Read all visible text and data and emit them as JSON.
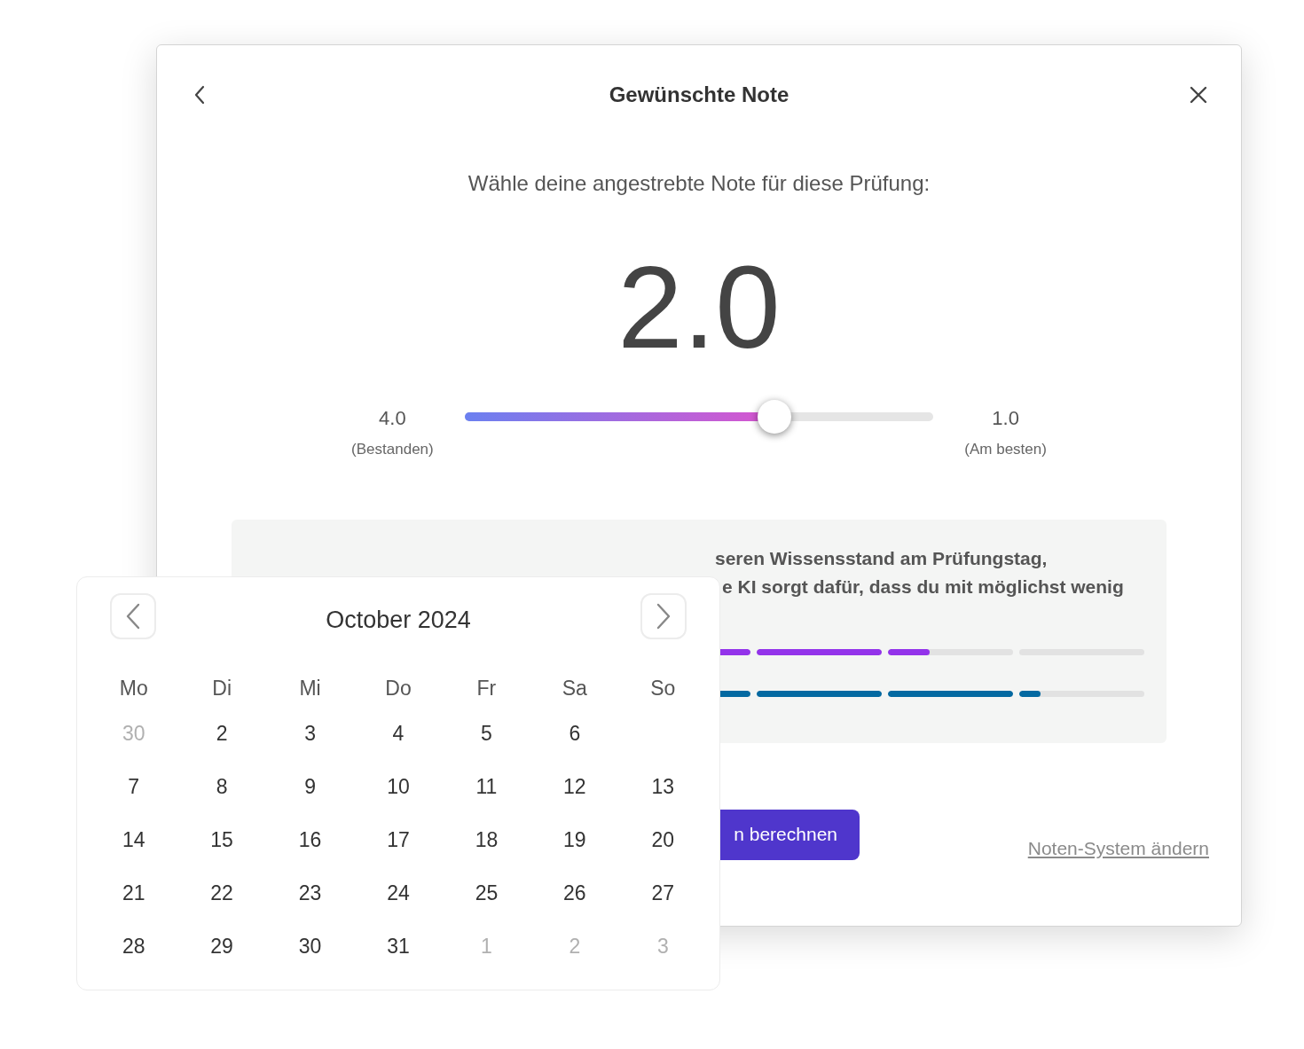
{
  "dialog": {
    "title": "Gewünschte Note",
    "prompt": "Wähle deine angestrebte Note für diese Prüfung:",
    "grade": "2.0",
    "slider": {
      "min_label": "4.0",
      "min_caption": "(Bestanden)",
      "max_label": "1.0",
      "max_caption": "(Am besten)",
      "level": 0.66
    },
    "info": {
      "lines": [
        "seren Wissensstand am Prüfungstag,",
        "e KI sorgt dafür, dass du mit möglichst wenig"
      ],
      "progress_rows": [
        {
          "color": "#9333ea",
          "segments": [
            {
              "level": 1
            },
            {
              "level": 1
            },
            {
              "level": 0.33
            },
            {
              "level": 0
            }
          ]
        },
        {
          "color": "#0369a1",
          "segments": [
            {
              "level": 1
            },
            {
              "level": 1
            },
            {
              "level": 1
            },
            {
              "level": 0.17
            }
          ]
        }
      ]
    },
    "primary_button": "n berechnen",
    "link": "Noten-System ändern"
  },
  "calendar": {
    "month": "October 2024",
    "weekdays": [
      "Mo",
      "Di",
      "Mi",
      "Do",
      "Fr",
      "Sa",
      "So"
    ],
    "weeks": [
      [
        {
          "day": "30",
          "outside": true
        },
        {
          "day": "2",
          "outside": false
        },
        {
          "day": "3",
          "outside": false
        },
        {
          "day": "4",
          "outside": false
        },
        {
          "day": "5",
          "outside": false
        },
        {
          "day": "6",
          "outside": false
        }
      ],
      [
        {
          "day": "7",
          "outside": false
        },
        {
          "day": "8",
          "outside": false
        },
        {
          "day": "9",
          "outside": false
        },
        {
          "day": "10",
          "outside": false
        },
        {
          "day": "11",
          "outside": false
        },
        {
          "day": "12",
          "outside": false
        },
        {
          "day": "13",
          "outside": false
        }
      ],
      [
        {
          "day": "14",
          "outside": false
        },
        {
          "day": "15",
          "outside": false
        },
        {
          "day": "16",
          "outside": false
        },
        {
          "day": "17",
          "outside": false
        },
        {
          "day": "18",
          "outside": false
        },
        {
          "day": "19",
          "outside": false
        },
        {
          "day": "20",
          "outside": false
        }
      ],
      [
        {
          "day": "21",
          "outside": false
        },
        {
          "day": "22",
          "outside": false
        },
        {
          "day": "23",
          "outside": false
        },
        {
          "day": "24",
          "outside": false
        },
        {
          "day": "25",
          "outside": false
        },
        {
          "day": "26",
          "outside": false
        },
        {
          "day": "27",
          "outside": false
        }
      ],
      [
        {
          "day": "28",
          "outside": false
        },
        {
          "day": "29",
          "outside": false
        },
        {
          "day": "30",
          "outside": false
        },
        {
          "day": "31",
          "outside": false
        },
        {
          "day": "1",
          "outside": true
        },
        {
          "day": "2",
          "outside": true
        },
        {
          "day": "3",
          "outside": true
        }
      ]
    ]
  }
}
